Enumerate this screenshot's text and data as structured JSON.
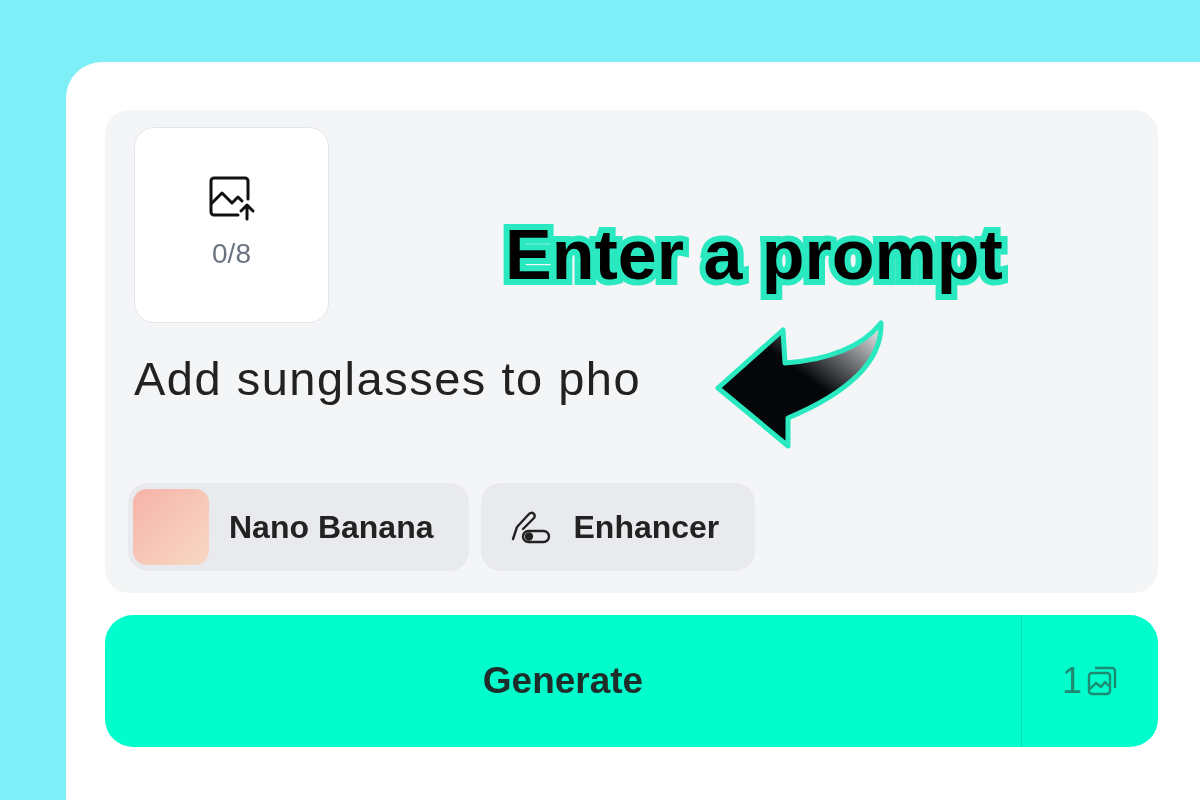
{
  "upload": {
    "count": "0/8"
  },
  "annotation": {
    "text": "Enter a prompt"
  },
  "prompt": {
    "value": "Add sunglasses to pho"
  },
  "chips": [
    {
      "kind": "model",
      "label": "Nano Banana"
    },
    {
      "kind": "tool",
      "label": "Enhancer"
    }
  ],
  "generate": {
    "label": "Generate",
    "count": "1"
  }
}
